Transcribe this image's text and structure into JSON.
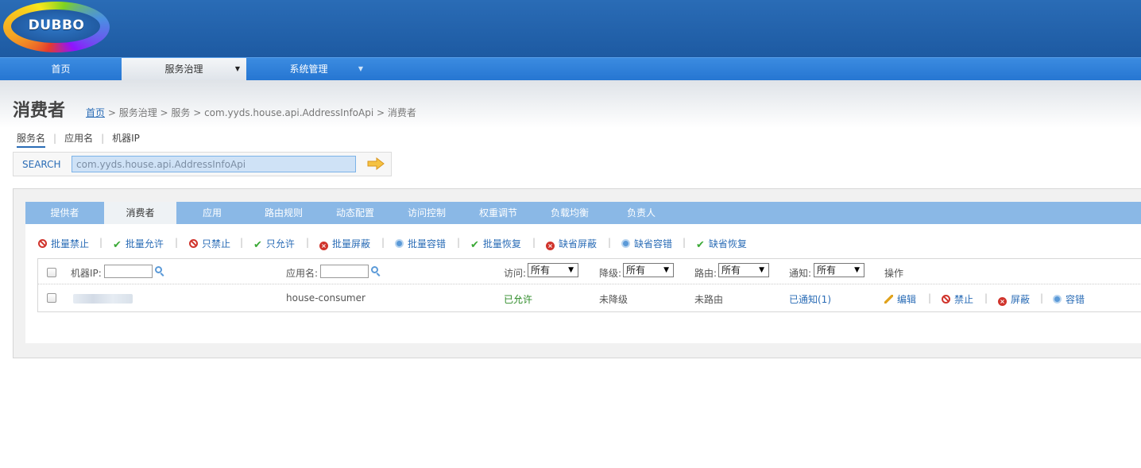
{
  "logo": {
    "text": "DUBBO"
  },
  "nav": {
    "items": [
      {
        "label": "首页"
      },
      {
        "label": "服务治理",
        "caret": "▼"
      },
      {
        "label": "系统管理",
        "caret": "▼"
      }
    ]
  },
  "page": {
    "title": "消费者",
    "breadcrumb": {
      "home": "首页",
      "rest": " > 服务治理 > 服务 > com.yyds.house.api.AddressInfoApi > 消费者"
    }
  },
  "search_tabs": [
    "服务名",
    "应用名",
    "机器IP"
  ],
  "search": {
    "label": "SEARCH",
    "value": "com.yyds.house.api.AddressInfoApi"
  },
  "tabs": [
    "提供者",
    "消费者",
    "应用",
    "路由规则",
    "动态配置",
    "访问控制",
    "权重调节",
    "负载均衡",
    "负责人"
  ],
  "actions": [
    "批量禁止",
    "批量允许",
    "只禁止",
    "只允许",
    "批量屏蔽",
    "批量容错",
    "批量恢复",
    "缺省屏蔽",
    "缺省容错",
    "缺省恢复"
  ],
  "table": {
    "headers": {
      "ip": "机器IP:",
      "app": "应用名:",
      "access": "访问:",
      "degrade": "降级:",
      "route": "路由:",
      "notify": "通知:",
      "ops": "操作"
    },
    "select_all": "所有",
    "rows": [
      {
        "app": "house-consumer",
        "access": "已允许",
        "degrade": "未降级",
        "route": "未路由",
        "notify": "已通知(1)",
        "ops": [
          "编辑",
          "禁止",
          "屏蔽",
          "容错"
        ]
      }
    ]
  },
  "colors": {
    "header_blue": "#2a6cb6",
    "nav_blue": "#3b8be0",
    "tab_bar": "#8ab8e6",
    "link": "#2a6cb6",
    "allowed_green": "#2e8b28",
    "forbid_red": "#d0342c"
  }
}
